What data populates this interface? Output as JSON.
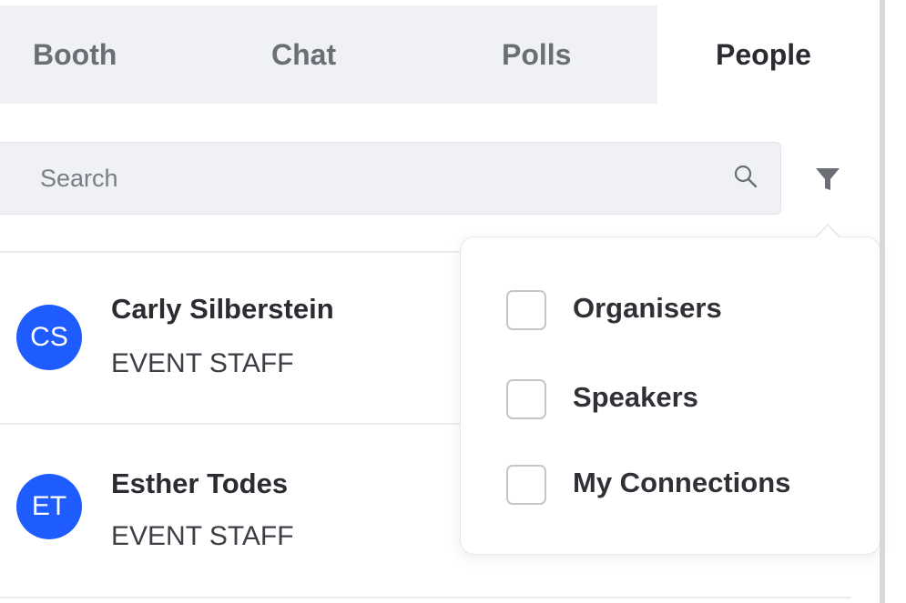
{
  "tabs": [
    {
      "label": "Booth",
      "active": false
    },
    {
      "label": "Chat",
      "active": false
    },
    {
      "label": "Polls",
      "active": false
    },
    {
      "label": "People",
      "active": true
    }
  ],
  "search": {
    "placeholder": "Search",
    "value": "",
    "icon": "search-icon"
  },
  "filter": {
    "icon": "filter-icon",
    "options": [
      {
        "label": "Organisers",
        "checked": false
      },
      {
        "label": "Speakers",
        "checked": false
      },
      {
        "label": "My Connections",
        "checked": false
      }
    ]
  },
  "people": [
    {
      "initials": "CS",
      "name": "Carly Silberstein",
      "role": "EVENT STAFF"
    },
    {
      "initials": "ET",
      "name": "Esther Todes",
      "role": "EVENT STAFF"
    }
  ],
  "colors": {
    "avatar": "#1f5cff",
    "tabbar_bg": "#f0f1f5",
    "text_dark": "#2a2c31",
    "text_muted": "#6b6e75"
  }
}
